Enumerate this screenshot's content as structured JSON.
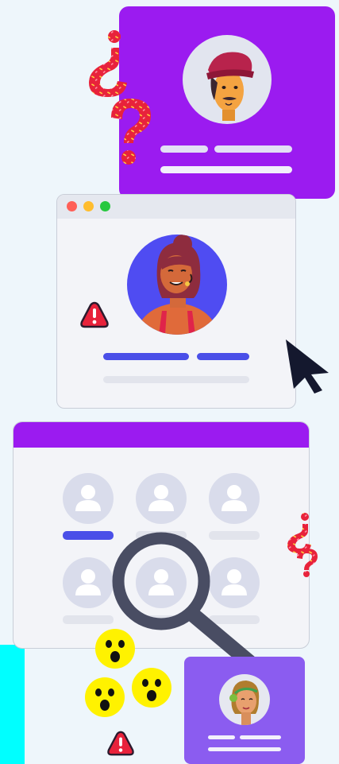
{
  "colors": {
    "background": "#eef6fb",
    "purple_card": "#9b1bf0",
    "violet_card": "#8b5cf0",
    "accent_blue": "#4a4fe8",
    "placeholder_gray": "#d9dceb",
    "warning_red": "#e8223b",
    "emoji_yellow": "#fff200",
    "cyan_strip": "#00ffff"
  },
  "window": {
    "dots": [
      "#ff5f57",
      "#ffbd2e",
      "#28c840"
    ]
  },
  "icons": {
    "top_question": "inverted-question-mark-icon",
    "top_question_2": "question-mark-icon",
    "side_question": "question-marks-icon",
    "warning_1": "warning-icon",
    "warning_2": "warning-icon",
    "cursor": "cursor-arrow-icon",
    "magnifier": "magnifying-glass-icon",
    "emoji": "surprised-face-icon"
  },
  "grid": {
    "rows": 2,
    "columns": 3,
    "highlighted_index": 0
  }
}
